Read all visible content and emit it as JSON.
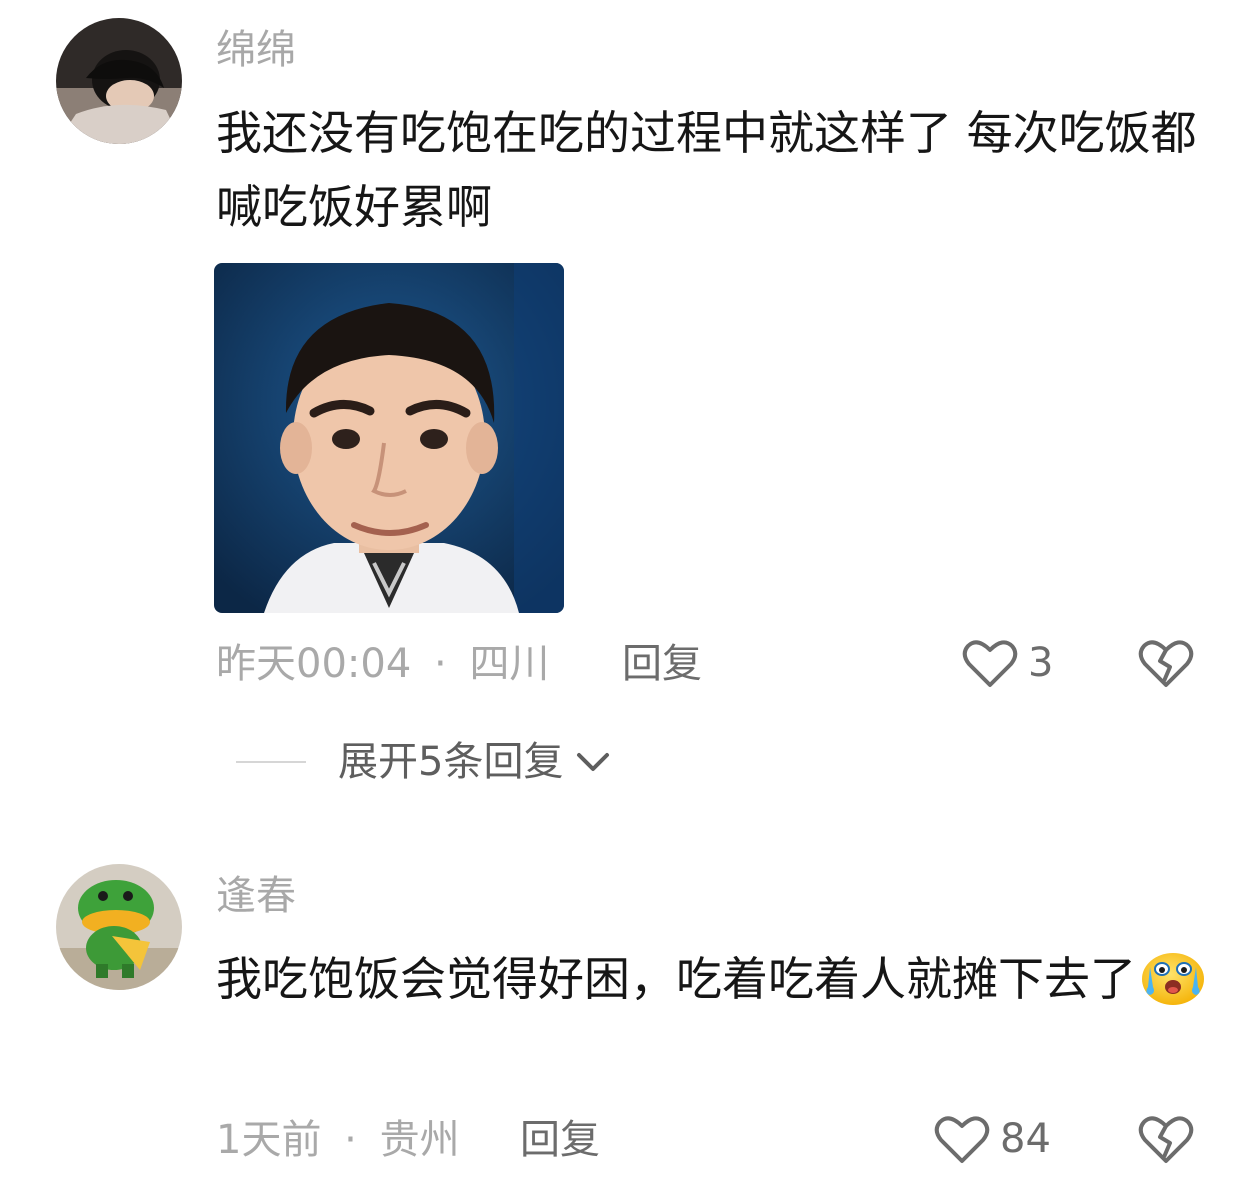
{
  "comments": [
    {
      "username": "绵绵",
      "text": "我还没有吃饱在吃的过程中就这样了 每次吃饭都喊吃饭好累啊",
      "time": "昨天00:04",
      "separator": "·",
      "location": "四川",
      "reply_label": "回复",
      "likes": "3",
      "has_image": true,
      "avatar_icon": "avatar-girl-resting",
      "image_icon": "smiling-man-photo"
    },
    {
      "username": "逢春",
      "text": "我吃饱饭会觉得好困，吃着吃着人就摊下去了",
      "time": "1天前",
      "separator": "·",
      "location": "贵州",
      "reply_label": "回复",
      "likes": "84",
      "emoji_icon": "crying-face-emoji",
      "avatar_icon": "avatar-green-figurine"
    }
  ],
  "expand_replies": {
    "label": "展开5条回复",
    "icon": "chevron-down-icon"
  },
  "colors": {
    "text": "#161616",
    "muted": "#a9a9a9",
    "action": "#6c6c6c"
  }
}
